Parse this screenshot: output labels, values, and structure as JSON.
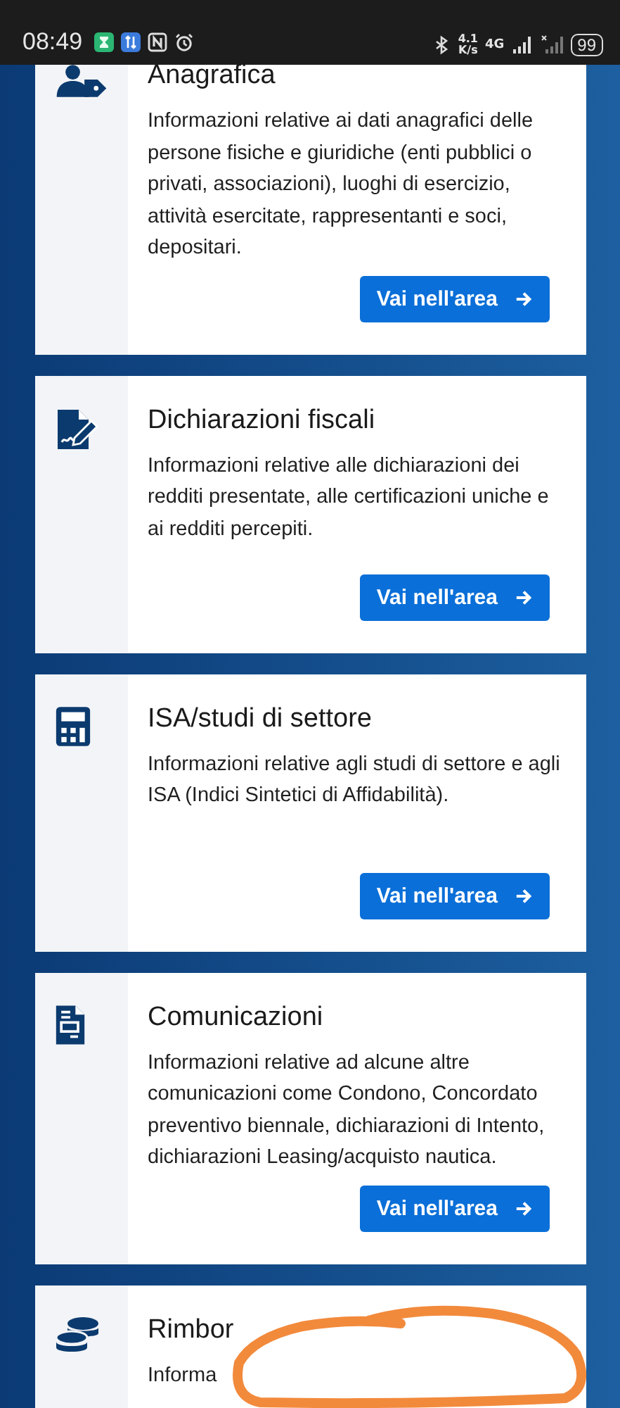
{
  "status_bar": {
    "time": "08:49",
    "speed_value": "4.1",
    "speed_unit": "K/s",
    "network": "4G",
    "battery": "99"
  },
  "cards": [
    {
      "title": "Anagrafica",
      "description": "Informazioni relative ai dati anagrafici delle persone fisiche e giuridiche (enti pubblici o privati, associazioni), luoghi di esercizio, attività esercitate, rappresentanti e soci, depositari.",
      "button": "Vai nell'area"
    },
    {
      "title": "Dichiarazioni fiscali",
      "description": "Informazioni relative alle dichiarazioni dei redditi presentate, alle certificazioni uniche e ai redditi percepiti.",
      "button": "Vai nell'area"
    },
    {
      "title": "ISA/studi di settore",
      "description": "Informazioni relative agli studi di settore e agli ISA (Indici Sintetici di Affidabilità).",
      "button": "Vai nell'area"
    },
    {
      "title": "Comunicazioni",
      "description": "Informazioni relative ad alcune altre comunicazioni come Condono, Concordato preventivo biennale, dichiarazioni di Intento, dichiarazioni Leasing/acquisto nautica.",
      "button": "Vai nell'area"
    },
    {
      "title": "Rimbor",
      "description": "Informa"
    }
  ],
  "scribble_mark": true
}
